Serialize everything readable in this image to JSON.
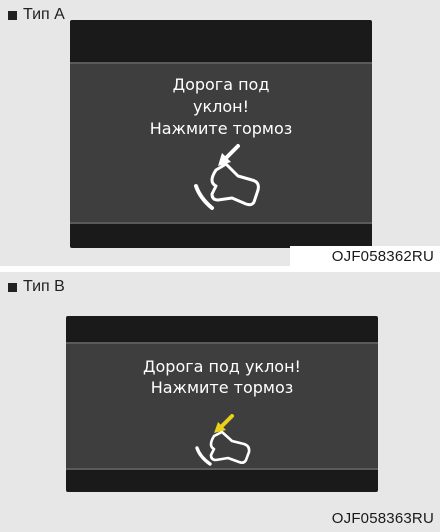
{
  "type_a": {
    "label": "Тип  A",
    "message_lines": [
      "Дорога под",
      "уклон!",
      "Нажмите тормоз"
    ],
    "code": "OJF058362RU",
    "arrow_color": "#ffffff",
    "icon": "brake-pedal-icon"
  },
  "type_b": {
    "label": "Тип  B",
    "message_lines": [
      "Дорога под уклон!",
      "Нажмите тормоз"
    ],
    "code": "OJF058363RU",
    "arrow_color": "#e8d21a",
    "icon": "brake-pedal-icon"
  }
}
